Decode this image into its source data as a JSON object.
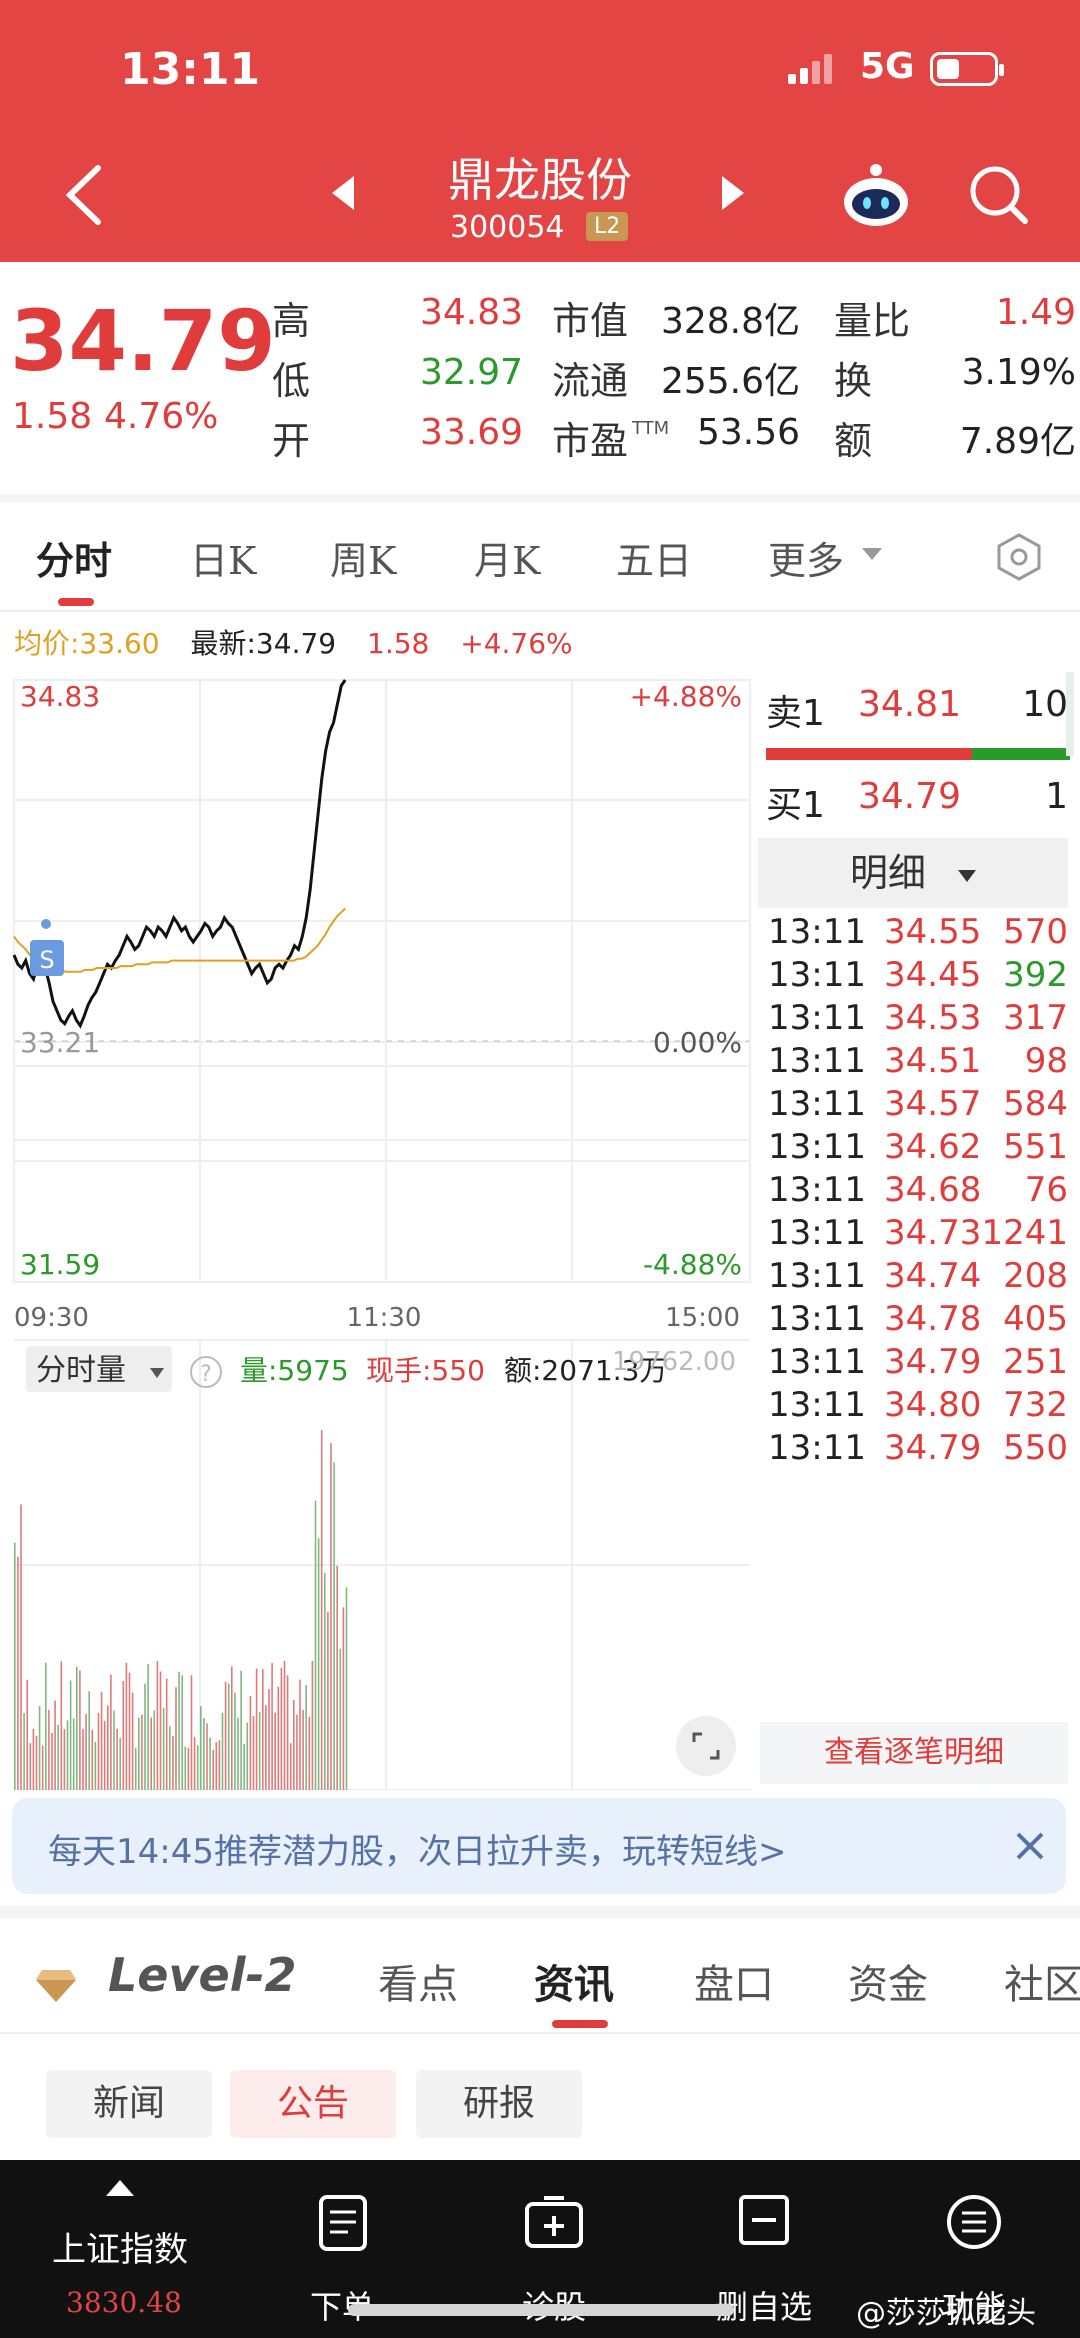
{
  "status": {
    "time": "13:11",
    "network": "5G"
  },
  "header": {
    "name": "鼎龙股份",
    "code": "300054",
    "badge": "L2"
  },
  "quote": {
    "price": "34.79",
    "change": "1.58",
    "change_pct": "4.76%",
    "high_label": "高",
    "high": "34.83",
    "low_label": "低",
    "low": "32.97",
    "open_label": "开",
    "open": "33.69",
    "mcap_label": "市值",
    "mcap": "328.8亿",
    "float_label": "流通",
    "float": "255.6亿",
    "pe_label": "市盈",
    "pe_sup": "TTM",
    "pe": "53.56",
    "vr_label": "量比",
    "vr": "1.49",
    "turn_label": "换",
    "turn": "3.19%",
    "amt_label": "额",
    "amt": "7.89亿"
  },
  "tabs": [
    "分时",
    "日K",
    "周K",
    "月K",
    "五日",
    "更多"
  ],
  "chart_info": {
    "avg": "均价:33.60",
    "last": "最新:34.79",
    "chg": "1.58",
    "pct": "+4.76%"
  },
  "chart_data": {
    "type": "line",
    "x_labels": [
      "09:30",
      "11:30",
      "15:00"
    ],
    "y_left": [
      "34.83",
      "33.21",
      "31.59"
    ],
    "y_right": [
      "+4.88%",
      "0.00%",
      "-4.88%"
    ],
    "ylim": [
      31.59,
      34.83
    ],
    "series": [
      {
        "values": [
          33.35,
          33.3,
          33.28,
          33.32,
          33.25,
          33.22,
          33.3,
          33.35,
          33.28,
          33.2,
          33.1,
          33.05,
          33.0,
          32.98,
          33.02,
          33.05,
          33.0,
          32.97,
          33.02,
          33.08,
          33.12,
          33.15,
          33.2,
          33.25,
          33.3,
          33.28,
          33.32,
          33.35,
          33.4,
          33.45,
          33.42,
          33.38,
          33.4,
          33.45,
          33.5,
          33.48,
          33.45,
          33.5,
          33.48,
          33.45,
          33.5,
          33.55,
          33.52,
          33.48,
          33.5,
          33.45,
          33.42,
          33.45,
          33.48,
          33.52,
          33.5,
          33.45,
          33.48,
          33.5,
          33.55,
          33.52,
          33.5,
          33.45,
          33.4,
          33.35,
          33.3,
          33.25,
          33.28,
          33.3,
          33.25,
          33.2,
          33.22,
          33.28,
          33.3,
          33.28,
          33.32,
          33.35,
          33.4,
          33.38,
          33.45,
          33.55,
          33.7,
          33.9,
          34.1,
          34.3,
          34.45,
          34.55,
          34.6,
          34.7,
          34.8,
          34.83
        ]
      },
      {
        "values": [
          33.45,
          33.42,
          33.4,
          33.38,
          33.35,
          33.33,
          33.32,
          33.31,
          33.3,
          33.29,
          33.28,
          33.27,
          33.27,
          33.26,
          33.26,
          33.26,
          33.26,
          33.26,
          33.27,
          33.27,
          33.27,
          33.28,
          33.28,
          33.28,
          33.28,
          33.28,
          33.28,
          33.29,
          33.29,
          33.29,
          33.29,
          33.3,
          33.3,
          33.3,
          33.3,
          33.31,
          33.31,
          33.31,
          33.31,
          33.31,
          33.32,
          33.32,
          33.32,
          33.32,
          33.32,
          33.32,
          33.32,
          33.32,
          33.32,
          33.32,
          33.32,
          33.32,
          33.32,
          33.32,
          33.32,
          33.32,
          33.32,
          33.32,
          33.32,
          33.32,
          33.32,
          33.32,
          33.32,
          33.32,
          33.32,
          33.32,
          33.32,
          33.32,
          33.32,
          33.32,
          33.32,
          33.32,
          33.33,
          33.33,
          33.34,
          33.36,
          33.38,
          33.4,
          33.43,
          33.46,
          33.5,
          33.53,
          33.56,
          33.58,
          33.6
        ]
      }
    ],
    "volume": {
      "label": "分时量",
      "vol": "量:5975",
      "cur": "现手:550",
      "amt": "额:2071.3万",
      "max": "19762.00"
    }
  },
  "orderbook": {
    "sell": {
      "label": "卖1",
      "price": "34.81",
      "qty": "10"
    },
    "buy": {
      "label": "买1",
      "price": "34.79",
      "qty": "1"
    },
    "detail_label": "明细",
    "trades": [
      {
        "t": "13:11",
        "p": "34.55",
        "q": "570",
        "c": "red"
      },
      {
        "t": "13:11",
        "p": "34.45",
        "q": "392",
        "c": "green"
      },
      {
        "t": "13:11",
        "p": "34.53",
        "q": "317",
        "c": "red"
      },
      {
        "t": "13:11",
        "p": "34.51",
        "q": "98",
        "c": "red"
      },
      {
        "t": "13:11",
        "p": "34.57",
        "q": "584",
        "c": "red"
      },
      {
        "t": "13:11",
        "p": "34.62",
        "q": "551",
        "c": "red"
      },
      {
        "t": "13:11",
        "p": "34.68",
        "q": "76",
        "c": "red"
      },
      {
        "t": "13:11",
        "p": "34.73",
        "q": "1241",
        "c": "red"
      },
      {
        "t": "13:11",
        "p": "34.74",
        "q": "208",
        "c": "red"
      },
      {
        "t": "13:11",
        "p": "34.78",
        "q": "405",
        "c": "red"
      },
      {
        "t": "13:11",
        "p": "34.79",
        "q": "251",
        "c": "red"
      },
      {
        "t": "13:11",
        "p": "34.80",
        "q": "732",
        "c": "red"
      },
      {
        "t": "13:11",
        "p": "34.79",
        "q": "550",
        "c": "red"
      }
    ],
    "more": "查看逐笔明细"
  },
  "banner": {
    "text": "每天14:45推荐潜力股，次日拉升卖，玩转短线>"
  },
  "bottom_tabs": {
    "level": "Level-2",
    "items": [
      "看点",
      "资讯",
      "盘口",
      "资金",
      "社区"
    ]
  },
  "chips": [
    "新闻",
    "公告",
    "研报"
  ],
  "nav": {
    "index_name": "上证指数",
    "index_value": "3830.48",
    "items": [
      "下单",
      "诊股",
      "删自选",
      "功能"
    ],
    "watermark": "@莎莎抓龙头"
  }
}
